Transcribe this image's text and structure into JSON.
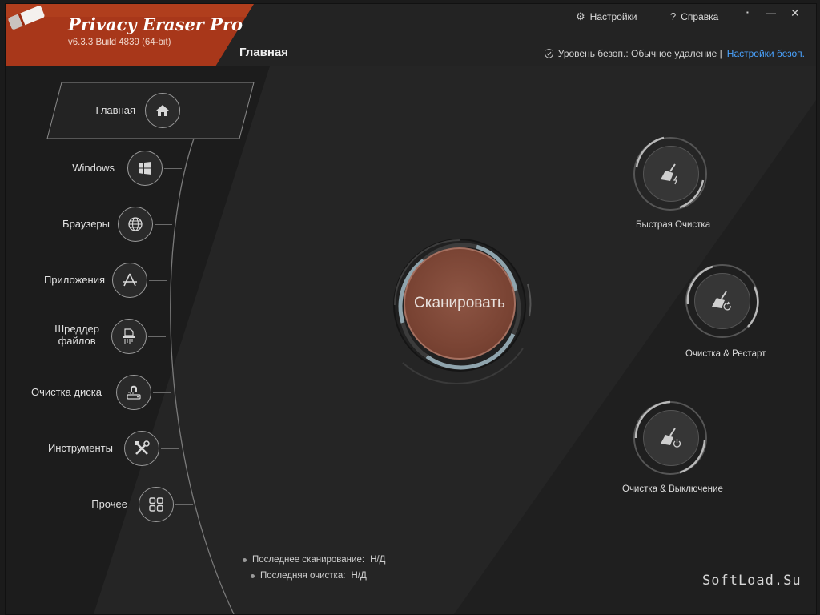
{
  "app": {
    "title": "Privacy Eraser Pro",
    "version": "v6.3.3 Build 4839 (64-bit)",
    "brand_color": "#b23b14"
  },
  "topbar": {
    "settings_label": "Настройки",
    "help_label": "Справка",
    "minimize_glyph": "▪",
    "maximize_glyph": "—",
    "close_glyph": "✕"
  },
  "header": {
    "page_title": "Главная",
    "security_text": "Уровень безоп.: Обычное удаление |",
    "security_link": "Настройки безоп."
  },
  "sidebar": {
    "items": [
      {
        "label": "Главная",
        "icon": "home-icon",
        "active": true
      },
      {
        "label": "Windows",
        "icon": "windows-icon"
      },
      {
        "label": "Браузеры",
        "icon": "globe-icon"
      },
      {
        "label": "Приложения",
        "icon": "app-store-icon"
      },
      {
        "label": "Шреддер\nфайлов",
        "label_line1": "Шреддер",
        "label_line2": "файлов",
        "icon": "shredder-icon"
      },
      {
        "label": "Очистка диска",
        "icon": "disk-magnet-icon"
      },
      {
        "label": "Инструменты",
        "icon": "tools-icon"
      },
      {
        "label": "Прочее",
        "icon": "grid-icon"
      }
    ]
  },
  "main": {
    "scan_label": "Сканировать",
    "actions": [
      {
        "label": "Быстрая Очистка",
        "icon": "broom-lightning-icon"
      },
      {
        "label": "Очистка & Рестарт",
        "icon": "broom-restart-icon"
      },
      {
        "label": "Очистка & Выключение",
        "icon": "broom-power-icon"
      }
    ],
    "status": {
      "last_scan_label": "Последнее сканирование:",
      "last_scan_value": "Н/Д",
      "last_clean_label": "Последняя очистка:",
      "last_clean_value": "Н/Д"
    }
  },
  "watermark": "SoftLoad.Su"
}
